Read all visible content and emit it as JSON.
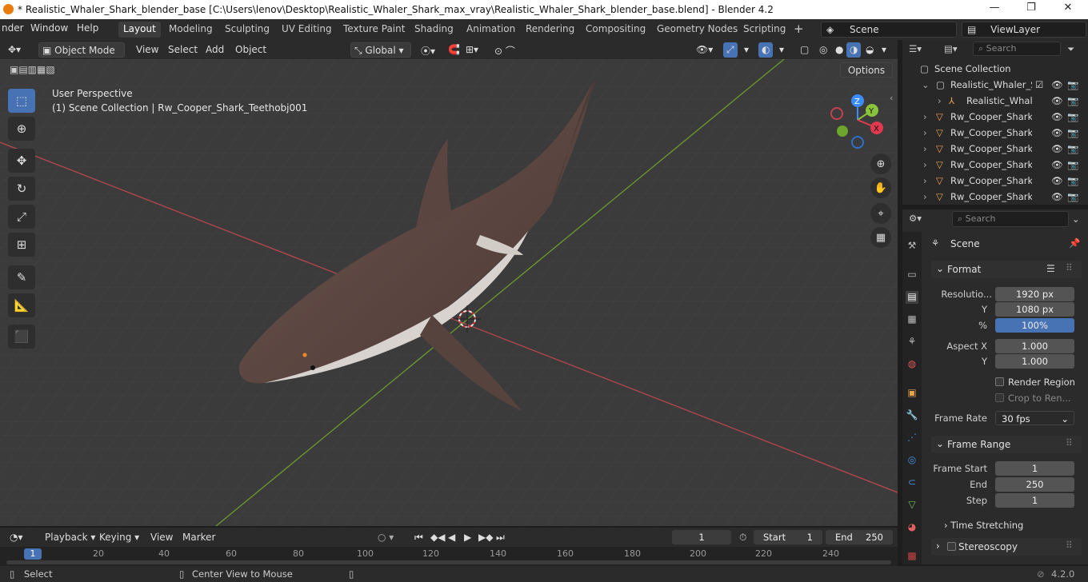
{
  "titlebar": {
    "title": "* Realistic_Whaler_Shark_blender_base [C:\\Users\\lenov\\Desktop\\Realistic_Whaler_Shark_max_vray\\Realistic_Whaler_Shark_blender_base.blend] - Blender 4.2",
    "min": "—",
    "max": "❐",
    "close": "✕"
  },
  "menus": [
    "nder",
    "Window",
    "Help"
  ],
  "workspaces": [
    "Layout",
    "Modeling",
    "Sculpting",
    "UV Editing",
    "Texture Paint",
    "Shading",
    "Animation",
    "Rendering",
    "Compositing",
    "Geometry Nodes",
    "Scripting"
  ],
  "scene": "Scene",
  "viewlayer": "ViewLayer",
  "vpheader": {
    "mode": "Object Mode",
    "view": "View",
    "select": "Select",
    "add": "Add",
    "object": "Object",
    "orientation": "Global",
    "options": "Options"
  },
  "viewport": {
    "perspective": "User Perspective",
    "collection_info": "(1) Scene Collection | Rw_Cooper_Shark_Teethobj001"
  },
  "gizmo": {
    "x": "X",
    "y": "Y",
    "z": "Z"
  },
  "outliner": {
    "search": "Search",
    "root": "Scene Collection",
    "items": [
      "Realistic_Whaler_Sh",
      "Realistic_Whale",
      "Rw_Cooper_Shark_",
      "Rw_Cooper_Shark_",
      "Rw_Cooper_Shark_",
      "Rw_Cooper_Shark_",
      "Rw_Cooper_Shark_",
      "Rw_Cooper_Shark_"
    ]
  },
  "props": {
    "search": "Search",
    "context": "Scene",
    "format": {
      "title": "Format",
      "res_label": "Resolutio...",
      "res_x": "1920 px",
      "y_label": "Y",
      "res_y": "1080 px",
      "pct_label": "%",
      "pct": "100%",
      "aspx_label": "Aspect X",
      "aspx": "1.000",
      "aspy_label": "Y",
      "aspy": "1.000",
      "render_region": "Render Region",
      "crop": "Crop to Ren...",
      "fr_label": "Frame Rate",
      "fr": "30 fps"
    },
    "frame_range": {
      "title": "Frame Range",
      "start_label": "Frame Start",
      "start": "1",
      "end_label": "End",
      "end": "250",
      "step_label": "Step",
      "step": "1",
      "time_stretching": "Time Stretching"
    },
    "stereoscopy": "Stereoscopy"
  },
  "timeline": {
    "playback": "Playback",
    "keying": "Keying",
    "view": "View",
    "marker": "Marker",
    "current": "1",
    "start_label": "Start",
    "start": "1",
    "end_label": "End",
    "end": "250",
    "ticks": [
      "1",
      "20",
      "40",
      "60",
      "80",
      "100",
      "120",
      "140",
      "160",
      "180",
      "200",
      "220",
      "240"
    ]
  },
  "status": {
    "select": "Select",
    "center": "Center View to Mouse",
    "version": "4.2.0"
  }
}
